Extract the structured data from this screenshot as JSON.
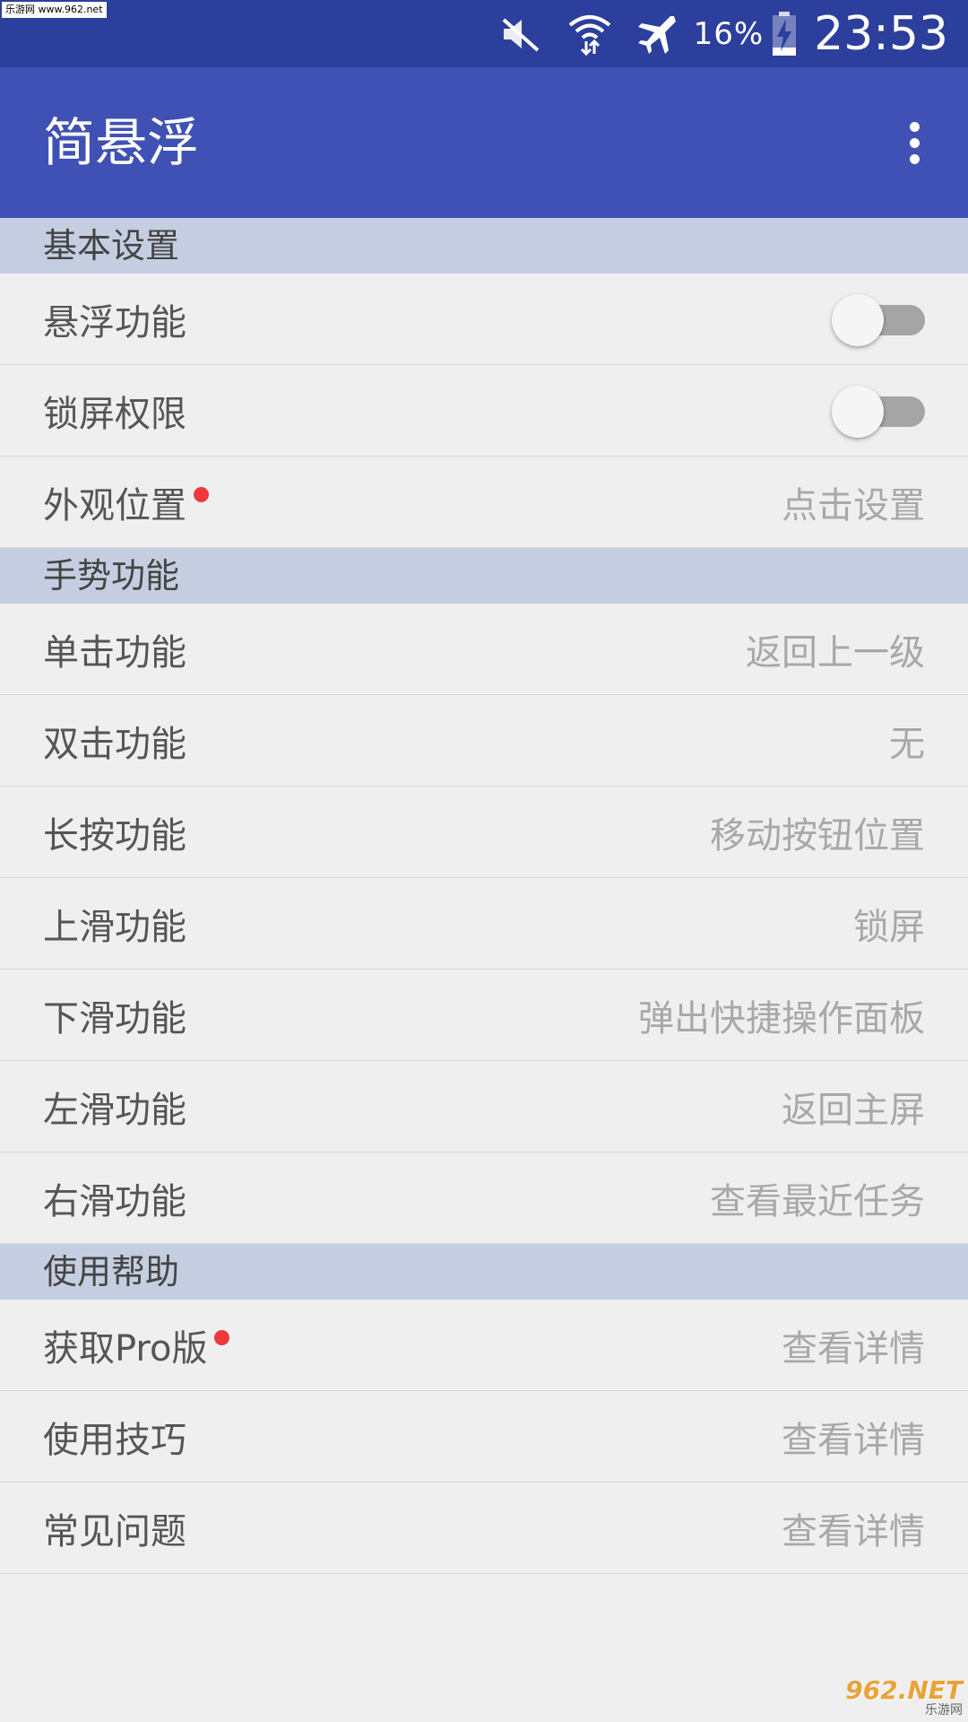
{
  "status_bar": {
    "watermark": "乐游网 www.962.net",
    "battery_percent": "16%",
    "time": "23:53",
    "icons": [
      "mute-icon",
      "wifi-icon",
      "airplane-icon",
      "battery-charging-icon"
    ]
  },
  "app_bar": {
    "title": "简悬浮",
    "menu_icon": "more-vert-icon"
  },
  "sections": {
    "basic": {
      "header": "基本设置",
      "float_function": {
        "label": "悬浮功能",
        "enabled": false
      },
      "lock_permission": {
        "label": "锁屏权限",
        "enabled": false
      },
      "appearance": {
        "label": "外观位置",
        "value": "点击设置",
        "badge": true
      }
    },
    "gesture": {
      "header": "手势功能",
      "items": [
        {
          "label": "单击功能",
          "value": "返回上一级"
        },
        {
          "label": "双击功能",
          "value": "无"
        },
        {
          "label": "长按功能",
          "value": "移动按钮位置"
        },
        {
          "label": "上滑功能",
          "value": "锁屏"
        },
        {
          "label": "下滑功能",
          "value": "弹出快捷操作面板"
        },
        {
          "label": "左滑功能",
          "value": "返回主屏"
        },
        {
          "label": "右滑功能",
          "value": "查看最近任务"
        }
      ]
    },
    "help": {
      "header": "使用帮助",
      "items": [
        {
          "label": "获取Pro版",
          "value": "查看详情",
          "badge": true
        },
        {
          "label": "使用技巧",
          "value": "查看详情"
        },
        {
          "label": "常见问题",
          "value": "查看详情"
        }
      ]
    }
  },
  "watermark_bottom": {
    "main": "962.NET",
    "sub": "乐游网"
  },
  "colors": {
    "status_bar": "#2c3f9c",
    "app_bar": "#3f51b5",
    "section_header": "#c5cee0",
    "badge": "#f0373b"
  }
}
